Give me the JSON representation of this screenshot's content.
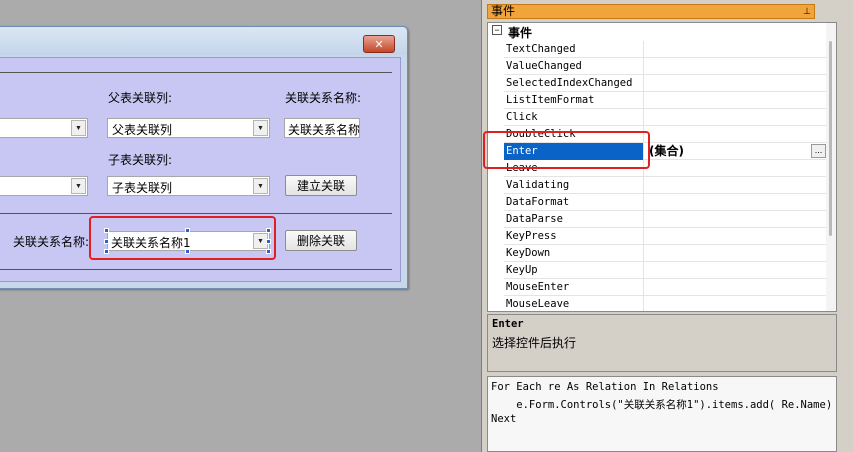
{
  "form": {
    "close_glyph": "✕",
    "label_parent_column": "父表关联列:",
    "label_relation_name_top": "关联关系名称:",
    "label_child_column": "子表关联列:",
    "label_relation_name": "关联关系名称:",
    "combo_parent_column": "父表关联列",
    "text_relation_name": "关联关系名称",
    "combo_child_column": "子表关联列",
    "combo_relation_name": "关联关系名称1",
    "btn_build_relation": "建立关联",
    "btn_delete_relation": "删除关联",
    "arrow_glyph": "▼"
  },
  "properties_panel": {
    "title": "事件",
    "pin_glyph": "⊥",
    "category_toggle": "−",
    "category": "事件",
    "events": [
      {
        "name": "TextChanged",
        "value": ""
      },
      {
        "name": "ValueChanged",
        "value": ""
      },
      {
        "name": "SelectedIndexChanged",
        "value": ""
      },
      {
        "name": "ListItemFormat",
        "value": ""
      },
      {
        "name": "Click",
        "value": ""
      },
      {
        "name": "DoubleClick",
        "value": ""
      },
      {
        "name": "Enter",
        "value": "(集合)"
      },
      {
        "name": "Leave",
        "value": ""
      },
      {
        "name": "Validating",
        "value": ""
      },
      {
        "name": "DataFormat",
        "value": ""
      },
      {
        "name": "DataParse",
        "value": ""
      },
      {
        "name": "KeyPress",
        "value": ""
      },
      {
        "name": "KeyDown",
        "value": ""
      },
      {
        "name": "KeyUp",
        "value": ""
      },
      {
        "name": "MouseEnter",
        "value": ""
      },
      {
        "name": "MouseLeave",
        "value": ""
      }
    ],
    "selected_event": "Enter",
    "ellipsis": "...",
    "description_title": "Enter",
    "description_text": "选择控件后执行",
    "code_lines": [
      "For Each re As Relation In Relations",
      "    e.Form.Controls(\"关联关系名称1\").items.add( Re.Name)",
      "Next"
    ]
  },
  "colors": {
    "form_client": "#c8c7f4",
    "selection": "#0a64c8",
    "highlight_box": "#e02020",
    "panel_title": "#f0a43a"
  }
}
